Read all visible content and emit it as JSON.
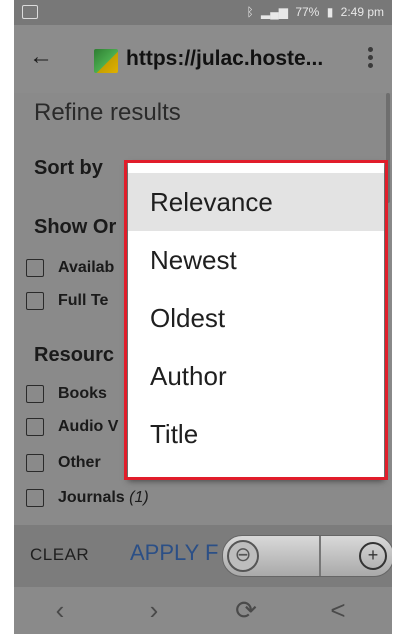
{
  "status_bar": {
    "icons": [
      "image-icon",
      "bluetooth-icon",
      "mute-icon",
      "volte-icon",
      "wifi-icon",
      "signal-icon"
    ],
    "battery": "77%",
    "time": "2:49 pm"
  },
  "toolbar": {
    "url": "https://julac.hoste..."
  },
  "page": {
    "refine_title": "Refine results",
    "sort_by": "Sort by",
    "show_only": "Show Or",
    "show_options": [
      "Availab",
      "Full Te"
    ],
    "resource_type": "Resourc",
    "resources": [
      {
        "label": "Books",
        "count": ""
      },
      {
        "label": "Audio V",
        "count": ""
      },
      {
        "label": "Other",
        "count": ""
      },
      {
        "label": "Journals",
        "count": "(1)"
      }
    ]
  },
  "sort_dropdown": {
    "options": [
      "Relevance",
      "Newest",
      "Oldest",
      "Author",
      "Title"
    ],
    "selected": "Relevance"
  },
  "bottom_bar": {
    "clear_label": "CLEAR",
    "apply_label": "APPLY F"
  },
  "nav": {
    "icons": [
      "back-icon",
      "forward-icon",
      "refresh-icon",
      "share-icon"
    ]
  },
  "colors": {
    "highlight": "#e11d2a",
    "link": "#2b4f86"
  }
}
